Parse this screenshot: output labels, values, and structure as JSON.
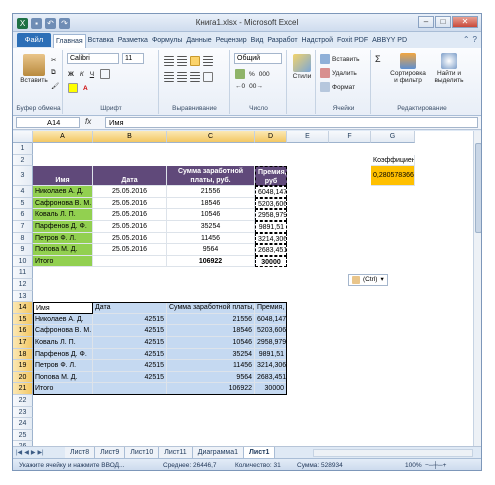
{
  "window": {
    "title": "Книга1.xlsx - Microsoft Excel",
    "controls": {
      "minimize": "–",
      "maximize": "□",
      "close": "✕"
    }
  },
  "ribbon_tabs": {
    "file": "Файл",
    "items": [
      "Главная",
      "Вставка",
      "Разметка",
      "Формулы",
      "Данные",
      "Рецензир",
      "Вид",
      "Разработ",
      "Надстрой",
      "Foxit PDF",
      "ABBYY PD"
    ],
    "active": 0
  },
  "ribbon": {
    "paste": "Вставить",
    "clipboard_group": "Буфер обмена",
    "font_name": "Calibri",
    "font_size": "11",
    "font_group": "Шрифт",
    "bold": "Ж",
    "italic": "К",
    "underline": "Ч",
    "align_group": "Выравнивание",
    "number_format": "Общий",
    "number_group": "Число",
    "styles": "Стили",
    "insert": "Вставить",
    "delete": "Удалить",
    "format": "Формат",
    "cells_group": "Ячейки",
    "sort": "Сортировка и фильтр",
    "find": "Найти и выделить",
    "edit_group": "Редактирование",
    "sum_symbol": "Σ"
  },
  "formula_bar": {
    "name_box": "A14",
    "fx": "fx",
    "formula": "Имя"
  },
  "columns": [
    "A",
    "B",
    "C",
    "D",
    "E",
    "F",
    "G"
  ],
  "rows": [
    "1",
    "2",
    "3",
    "4",
    "5",
    "6",
    "7",
    "8",
    "9",
    "10",
    "11",
    "12",
    "13",
    "14",
    "15",
    "16",
    "17",
    "18",
    "19",
    "20",
    "21",
    "22",
    "23",
    "24",
    "25",
    "26"
  ],
  "table1": {
    "headers": [
      "Имя",
      "Дата",
      "Сумма заработной платы, руб.",
      "Премия, руб"
    ],
    "rows": [
      [
        "Николаев А. Д.",
        "25.05.2016",
        "21556",
        "6048,147"
      ],
      [
        "Сафронова В. М.",
        "25.05.2016",
        "18546",
        "5203,606"
      ],
      [
        "Коваль Л. П.",
        "25.05.2016",
        "10546",
        "2958,979"
      ],
      [
        "Парфенов Д. Ф.",
        "25.05.2016",
        "35254",
        "9891,51"
      ],
      [
        "Петров Ф. Л.",
        "25.05.2016",
        "11456",
        "3214,306"
      ],
      [
        "Попова М. Д.",
        "25.05.2016",
        "9564",
        "2683,451"
      ]
    ],
    "total": [
      "Итого",
      "",
      "106922",
      "30000"
    ]
  },
  "coefficient": {
    "label": "Коэффициент",
    "value": "0,280578366"
  },
  "table2": {
    "headers": [
      "Имя",
      "Дата",
      "Сумма заработной платы, р",
      "Премия, руб"
    ],
    "rows": [
      [
        "Николаев А. Д.",
        "42515",
        "21556",
        "6048,147"
      ],
      [
        "Сафронова В. М.",
        "42515",
        "18546",
        "5203,606"
      ],
      [
        "Коваль Л. П.",
        "42515",
        "10546",
        "2958,979"
      ],
      [
        "Парфенов Д. Ф.",
        "42515",
        "35254",
        "9891,51"
      ],
      [
        "Петров Ф. Л.",
        "42515",
        "11456",
        "3214,306"
      ],
      [
        "Попова М. Д.",
        "42515",
        "9564",
        "2683,451"
      ]
    ],
    "total": [
      "Итого",
      "",
      "106922",
      "30000"
    ]
  },
  "paste_options": "(Ctrl)",
  "sheets": {
    "items": [
      "Лист8",
      "Лист9",
      "Лист10",
      "Лист11",
      "Диаграмма1",
      "Лист1"
    ],
    "active": 5
  },
  "status": {
    "message": "Укажите ячейку и нажмите ВВОД...",
    "average": "Среднее: 26446,7",
    "count": "Количество: 31",
    "sum": "Сумма: 528934",
    "zoom": "100%"
  },
  "colors": {
    "purple": "#60497a",
    "green": "#92d050",
    "orange": "#ffc000",
    "selection": "#c5d9f1"
  }
}
